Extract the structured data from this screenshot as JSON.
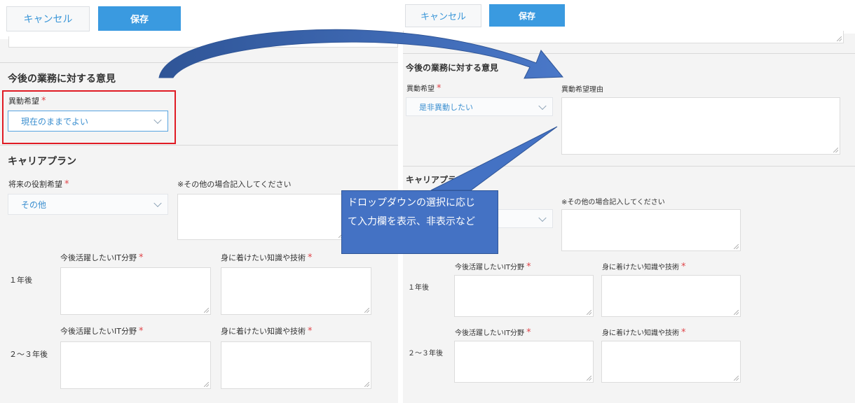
{
  "left": {
    "cancel_label": "キャンセル",
    "save_label": "保存",
    "section_future": "今後の業務に対する意見",
    "transfer_label": "異動希望",
    "transfer_value": "現在のままでよい",
    "section_career": "キャリアプラン",
    "role_label": "将来の役割希望",
    "role_value": "その他",
    "other_note": "※その他の場合記入してください",
    "it_field_label": "今後活躍したいIT分野",
    "skills_label": "身に着けたい知識や技術",
    "year1": "１年後",
    "year23": "２～３年後"
  },
  "right": {
    "cancel_label": "キャンセル",
    "save_label": "保存",
    "section_future": "今後の業務に対する意見",
    "transfer_label": "異動希望",
    "transfer_value": "是非異動したい",
    "transfer_reason_label": "異動希望理由",
    "section_career": "キャリアプラン",
    "other_note": "※その他の場合記入してください",
    "it_field_label": "今後活躍したいIT分野",
    "skills_label": "身に着けたい知識や技術",
    "year1": "１年後",
    "year23": "２～３年後"
  },
  "callout": {
    "line1": "ドロップダウンの選択に応じ",
    "line2": "て入力欄を表示、非表示など"
  },
  "colors": {
    "accent": "#3a9ae0",
    "required": "#e0454a",
    "highlight": "#e01b24",
    "callout": "#4472c4"
  },
  "icons": [
    "chevron-down-icon",
    "resize-grip-icon",
    "curved-arrow",
    "callout-pointer"
  ]
}
